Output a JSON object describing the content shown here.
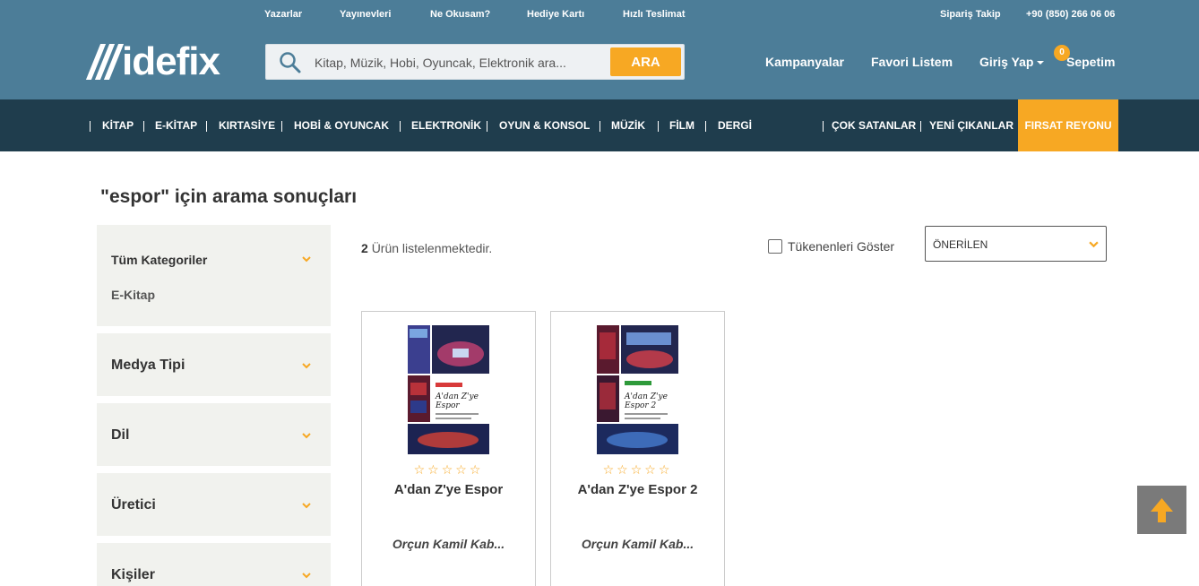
{
  "top_links": {
    "yazarlar": "Yazarlar",
    "yayinevleri": "Yayınevleri",
    "ne_okusam": "Ne Okusam?",
    "hediye_karti": "Hediye Kartı",
    "hizli_teslimat": "Hızlı Teslimat",
    "siparis_takip": "Sipariş Takip",
    "phone": "+90 (850) 266 06 06"
  },
  "logo": {
    "text": "idefix"
  },
  "search": {
    "placeholder": "Kitap, Müzik, Hobi, Oyuncak, Elektronik ara...",
    "button": "ARA"
  },
  "header_links": {
    "kampanyalar": "Kampanyalar",
    "favori": "Favori Listem",
    "giris": "Giriş Yap",
    "sepet": "Sepetim",
    "cart_count": "0"
  },
  "nav": {
    "items": [
      "KİTAP",
      "E-KİTAP",
      "KIRTASİYE",
      "HOBİ & OYUNCAK",
      "ELEKTRONİK",
      "OYUN & KONSOL",
      "MÜZİK",
      "FİLM",
      "DERGİ"
    ],
    "right_items": [
      "ÇOK SATANLAR",
      "YENİ ÇIKANLAR"
    ],
    "highlight": "FIRSAT REYONU"
  },
  "page": {
    "title": "\"espor\" için arama sonuçları"
  },
  "filters": {
    "all_categories": "Tüm Kategoriler",
    "all_categories_sub": "E-Kitap",
    "medya": "Medya Tipi",
    "dil": "Dil",
    "uretici": "Üretici",
    "kisiler": "Kişiler"
  },
  "results": {
    "count": "2",
    "count_text": "Ürün listelenmektedir.",
    "show_out_of_stock": "Tükenenleri Göster",
    "sort_value": "ÖNERİLEN"
  },
  "products": [
    {
      "title": "A'dan Z'ye Espor",
      "author": "Orçun Kamil Kab...",
      "stars": "☆☆☆☆☆",
      "cover_title_1": "A'dan Z'ye",
      "cover_title_2": "Espor"
    },
    {
      "title": "A'dan Z'ye Espor 2",
      "author": "Orçun Kamil Kab...",
      "stars": "☆☆☆☆☆",
      "cover_title_1": "A'dan Z'ye",
      "cover_title_2": "Espor 2"
    }
  ],
  "colors": {
    "header_blue": "#4c7d98",
    "nav_dark": "#1f3d4d",
    "accent_orange": "#f7a823",
    "filter_bg": "#f1f2ee"
  }
}
